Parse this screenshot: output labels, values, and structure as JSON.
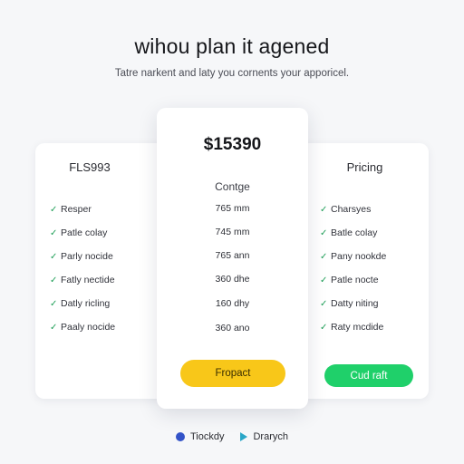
{
  "header": {
    "title": "wihou plan it agened",
    "subtitle": "Tatre narkent and laty you cornents your apporicel."
  },
  "plans": {
    "left": {
      "title": "FLS993",
      "features": [
        "Resper",
        "Patle colay",
        "Parly nocide",
        "Fatly nectide",
        "Datly ricling",
        "Paaly nocide"
      ]
    },
    "center": {
      "price": "$15390",
      "subtitle": "Contge",
      "features": [
        "765 mm",
        "745 mm",
        "765 ann",
        "360 dhe",
        "160 dhy",
        "360 ano"
      ],
      "button_label": "Fropact"
    },
    "right": {
      "title": "Pricing",
      "features": [
        "Charsyes",
        "Batle colay",
        "Pany nookde",
        "Patle nocte",
        "Datty niting",
        "Raty mcdide"
      ],
      "button_label": "Cud raft"
    }
  },
  "footer": {
    "left_label": "Tiockdy",
    "right_label": "Drarych"
  },
  "colors": {
    "accent_yellow": "#f8c719",
    "accent_green": "#1fd06a",
    "check_green": "#22a05a"
  }
}
